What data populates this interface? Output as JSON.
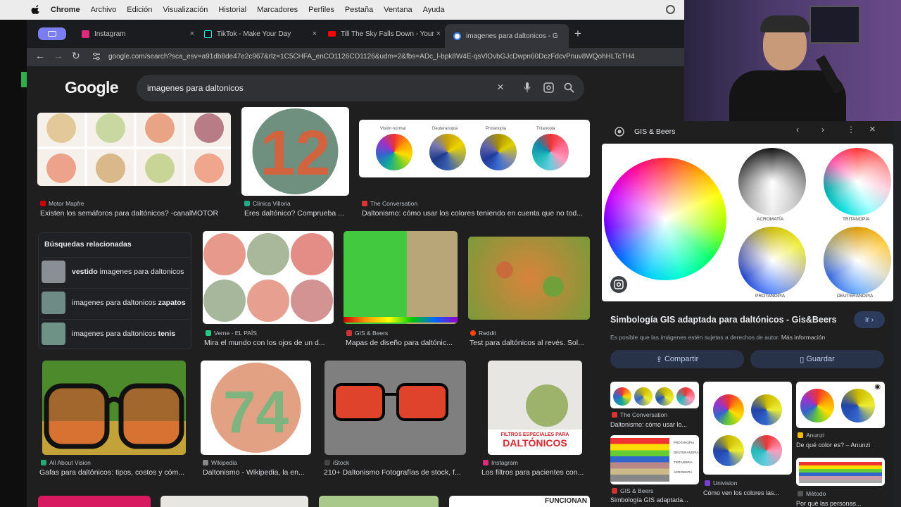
{
  "os_menubar": {
    "items": [
      "Chrome",
      "Archivo",
      "Edición",
      "Visualización",
      "Historial",
      "Marcadores",
      "Perfiles",
      "Pestaña",
      "Ventana",
      "Ayuda"
    ]
  },
  "tabs": [
    {
      "title": "Instagram",
      "color": "#dd2a7b"
    },
    {
      "title": "TikTok - Make Your Day",
      "color": "#111111"
    },
    {
      "title": "Till The Sky Falls Down - Your",
      "color": "#ff0000"
    },
    {
      "title": "imagenes para daltonicos - G",
      "color": "#4285f4",
      "active": true
    }
  ],
  "close_glyph": "×",
  "new_tab_glyph": "+",
  "address": {
    "url": "google.com/search?sca_esv=a91db8de47e2c967&rlz=1C5CHFA_enCO1126CO1126&udm=2&fbs=ADc_l-bpk8W4E-qsVlOvbGJcDwpn60DczFdcvPnuv8WQohHLTcTH4"
  },
  "search": {
    "logo": "Google",
    "query": "imagenes para daltonicos"
  },
  "results_row1": [
    {
      "source": "Motor Mapfre",
      "caption": "Existen los semáforos para daltónicos? -canalMOTOR",
      "color": "#c00"
    },
    {
      "source": "Clínica Villoria",
      "caption": "Eres daltónico? Comprueba ...",
      "color": "#2a8"
    },
    {
      "source": "The Conversation",
      "caption": "Daltonismo: cómo usar los colores teniendo en cuenta que no tod...",
      "color": "#d33"
    }
  ],
  "ishihara_numbers": [
    "12",
    "74"
  ],
  "vision_labels": [
    "Visión normal",
    "Deuteranopia",
    "Protanopia",
    "Tritanopia"
  ],
  "related": {
    "heading": "Búsquedas relacionadas",
    "items": [
      {
        "pre": "vestido",
        "rest": " imagenes para daltonicos"
      },
      {
        "pre": "imagenes para daltonicos ",
        "rest": "zapatos"
      },
      {
        "pre": "imagenes para daltonicos ",
        "rest": "tenis"
      }
    ]
  },
  "results_row2": [
    {
      "source": "Verne - EL PAÍS",
      "caption": "Mira el mundo con los ojos de un d...",
      "color": "#2c8"
    },
    {
      "source": "GIS & Beers",
      "caption": "Mapas de diseño para daltónic...",
      "color": "#c33"
    },
    {
      "source": "Reddit",
      "caption": "Test para daltónicos al revés. Sol...",
      "color": "#ff4500"
    }
  ],
  "results_row3": [
    {
      "source": "All About Vision",
      "caption": "Gafas para daltónicos: tipos, costos y cóm...",
      "color": "#2a7"
    },
    {
      "source": "Wikipedia",
      "caption": "Daltonismo - Wikipedia, la en...",
      "color": "#888"
    },
    {
      "source": "iStock",
      "caption": "210+ Daltonismo Fotografías de stock, f...",
      "color": "#444"
    },
    {
      "source": "Instagram",
      "caption": "Los filtros para pacientes con...",
      "color": "#dd2a7b"
    }
  ],
  "glasses_banner": {
    "line1": "FILTROS ESPECIALES PARA",
    "line2": "DALTÓNICOS"
  },
  "row4_partial_text": "FUNCIONAN",
  "panel": {
    "site": "GIS & Beers",
    "title": "Simbología GIS adaptada para daltónicos - Gis&Beers",
    "visit": "Ir",
    "notice": "Es posible que las imágenes estén sujetas a derechos de autor. ",
    "more": "Más información",
    "share": "Compartir",
    "save": "Guardar",
    "wheel_labels": [
      "ACROMATÍA",
      "TRITANOPIA",
      "PROTANOPIA",
      "DEUTERANOPIA"
    ],
    "related": [
      {
        "source": "The Conversation",
        "caption": "Daltonismo: cómo usar lo..."
      },
      {
        "source": "GIS & Beers",
        "caption": "Simbología GIS adaptada..."
      },
      {
        "source": "Univision",
        "caption": "Cómo ven los colores las..."
      },
      {
        "source": "Anunzi",
        "caption": "De qué color es? – Anunzi"
      },
      {
        "source": "Método",
        "caption": "Por qué las personas..."
      }
    ],
    "bar_labels": [
      "PROTANOPIA",
      "DEUTERANOPIA",
      "TRITANOPIA",
      "ACROMATIA"
    ]
  }
}
